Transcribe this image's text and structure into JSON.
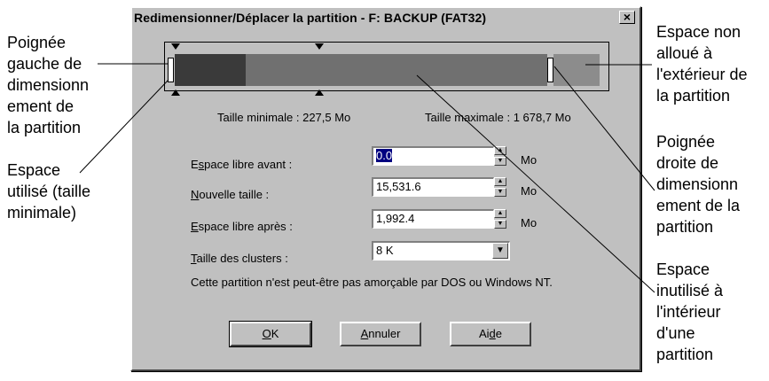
{
  "callouts": {
    "left_handle": "Poignée\ngauche de\ndimensionn\nement de\nla partition",
    "used_space": "Espace\nutilisé (taille\nminimale)",
    "unallocated": "Espace non\nalloué à\nl'extérieur de\nla partition",
    "right_handle": "Poignée\ndroite de\ndimensionn\nement de la\npartition",
    "unused_space": "Espace\ninutilisé à\nl'intérieur\nd'une\npartition"
  },
  "dialog": {
    "title": "Redimensionner/Déplacer la partition - F: BACKUP (FAT32)",
    "close_label": "×",
    "min_size_label": "Taille minimale : 227,5 Mo",
    "max_size_label": "Taille maximale : 1 678,7 Mo",
    "free_before": {
      "label_pre": "E",
      "label_key": "s",
      "label_post": "pace libre avant :",
      "value": "0.0",
      "unit": "Mo"
    },
    "new_size": {
      "label_key": "N",
      "label_post": "ouvelle taille :",
      "value": "15,531.6",
      "unit": "Mo"
    },
    "free_after": {
      "label_key": "E",
      "label_post": "space libre après :",
      "value": "1,992.4",
      "unit": "Mo"
    },
    "cluster_size": {
      "label_key": "T",
      "label_post": "aille des clusters :",
      "value": "8 K"
    },
    "warning": "Cette partition n'est peut-être pas amorçable par DOS ou Windows NT.",
    "ok_key": "O",
    "ok_post": "K",
    "cancel_key": "A",
    "cancel_post": "nnuler",
    "help_pre": "Ai",
    "help_key": "d",
    "help_post": "e"
  },
  "colors": {
    "used": "#3a3a3a",
    "unused": "#707070",
    "unallocated": "#8c8c8c",
    "dialog_bg": "#c0c0c0",
    "selection": "#000080"
  }
}
